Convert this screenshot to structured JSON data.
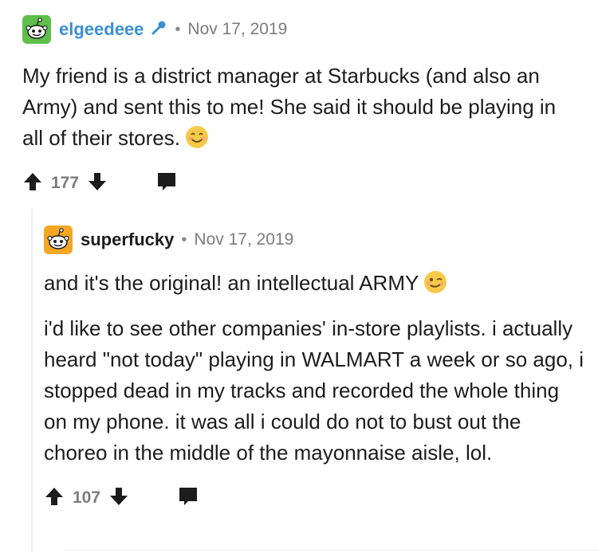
{
  "comments": [
    {
      "username": "elgeedeee",
      "separator": "•",
      "date": "Nov 17, 2019",
      "body": "My friend is a district manager at Starbucks (and also an Army) and sent this to me! She said it should be playing in all of their stores.",
      "votes": "177"
    },
    {
      "username": "superfucky",
      "separator": "•",
      "date": "Nov 17, 2019",
      "paragraph1": "and it's the original! an intellectual ARMY",
      "paragraph2": "i'd like to see other companies' in-store playlists. i actually heard \"not today\" playing in WALMART a week or so ago, i stopped dead in my tracks and recorded the whole thing on my phone. it was all i could do not to bust out the choreo in the middle of the mayonnaise aisle, lol.",
      "votes": "107"
    }
  ],
  "colors": {
    "username1": "#3a8fd6",
    "username2": "#1c1c1c",
    "meta": "#7c7c7c",
    "icon": "#1c1c1c",
    "avatar1": "#5fbf4a",
    "avatar2": "#f5a623",
    "emoji": "#f7c948"
  },
  "icons": {
    "upvote": "upvote-arrow-icon",
    "downvote": "downvote-arrow-icon",
    "reply": "comment-bubble-icon",
    "mod": "microphone-icon",
    "smile": "smiling-face-emoji",
    "wink": "winking-face-emoji"
  }
}
